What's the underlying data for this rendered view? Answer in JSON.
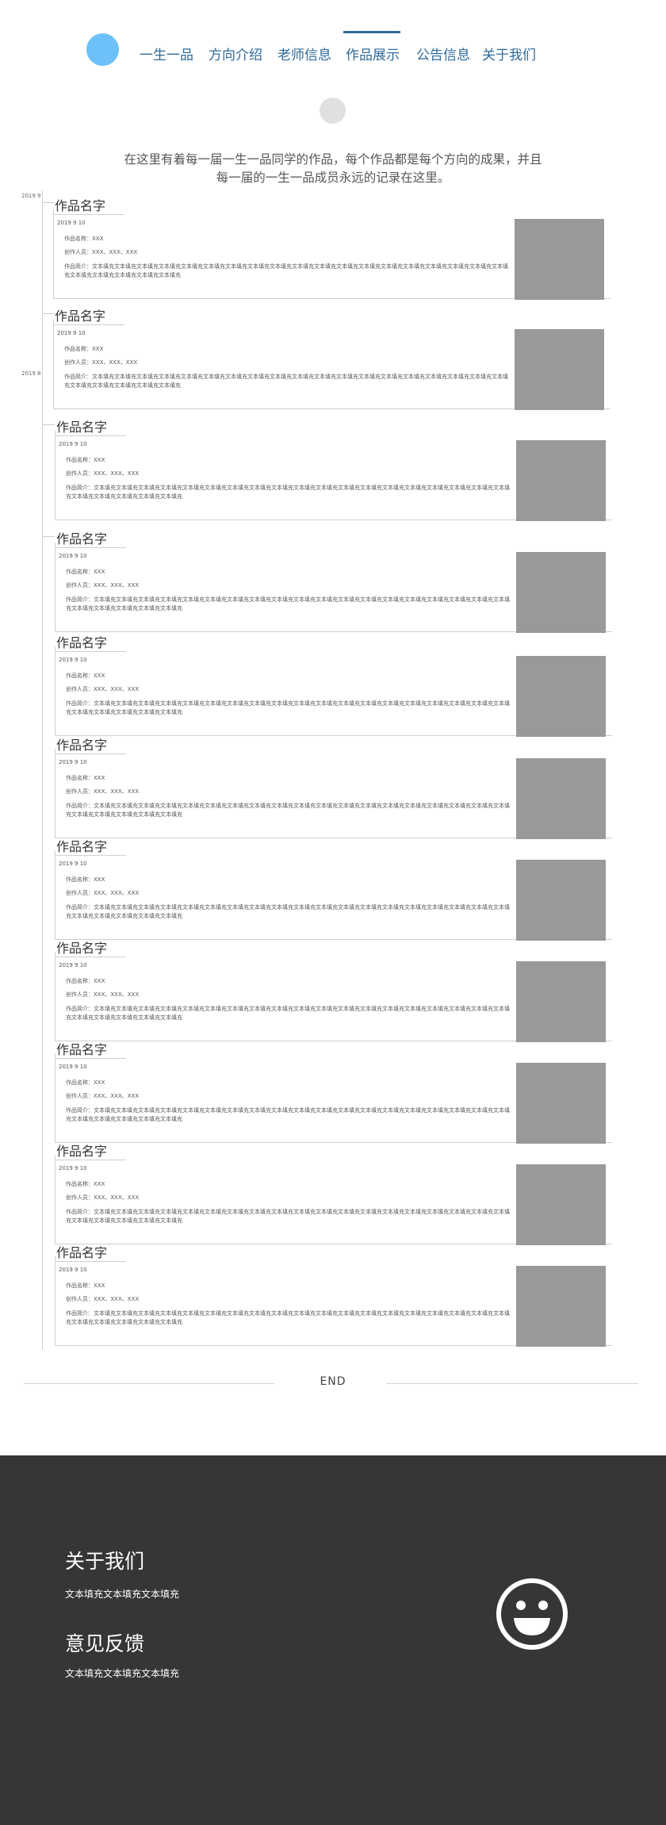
{
  "nav": {
    "items": [
      {
        "label": "一生一品"
      },
      {
        "label": "方向介绍"
      },
      {
        "label": "老师信息"
      },
      {
        "label": "作品展示",
        "active": true
      },
      {
        "label": "公告信息"
      },
      {
        "label": "关于我们"
      }
    ]
  },
  "intro": {
    "text": "在这里有着每一届一生一品同学的作品，每个作品都是每个方向的成果，并且每一届的一生一品成员永远的记录在这里。"
  },
  "timeline": {
    "dates": [
      "2019 9",
      "2019 8"
    ]
  },
  "works": [
    {
      "title": "作品名字",
      "date": "2019 9 10",
      "name": "作品名称：XXX",
      "authors": "创作人员：XXX、XXX、XXX",
      "desc": "作品简介：文本填充文本填充文本填充文本填充文本填充文本填充文本填充文本填充文本填充文本填充文本填充文本填充文本填充文本填充文本填充文本填充文本填充文本填充文本填充文本填充文本填充文本填充文本填充文本填充"
    },
    {
      "title": "作品名字",
      "date": "2019 9 10",
      "name": "作品名称：XXX",
      "authors": "创作人员：XXX、XXX、XXX",
      "desc": "作品简介：文本填充文本填充文本填充文本填充文本填充文本填充文本填充文本填充文本填充文本填充文本填充文本填充文本填充文本填充文本填充文本填充文本填充文本填充文本填充文本填充文本填充文本填充文本填充文本填充"
    },
    {
      "title": "作品名字",
      "date": "2019 9 10",
      "name": "作品名称：XXX",
      "authors": "创作人员：XXX、XXX、XXX",
      "desc": "作品简介：文本填充文本填充文本填充文本填充文本填充文本填充文本填充文本填充文本填充文本填充文本填充文本填充文本填充文本填充文本填充文本填充文本填充文本填充文本填充文本填充文本填充文本填充文本填充文本填充"
    },
    {
      "title": "作品名字",
      "date": "2019 9 10",
      "name": "作品名称：XXX",
      "authors": "创作人员：XXX、XXX、XXX",
      "desc": "作品简介：文本填充文本填充文本填充文本填充文本填充文本填充文本填充文本填充文本填充文本填充文本填充文本填充文本填充文本填充文本填充文本填充文本填充文本填充文本填充文本填充文本填充文本填充文本填充文本填充"
    },
    {
      "title": "作品名字",
      "date": "2019 9 10",
      "name": "作品名称：XXX",
      "authors": "创作人员：XXX、XXX、XXX",
      "desc": "作品简介：文本填充文本填充文本填充文本填充文本填充文本填充文本填充文本填充文本填充文本填充文本填充文本填充文本填充文本填充文本填充文本填充文本填充文本填充文本填充文本填充文本填充文本填充文本填充文本填充"
    },
    {
      "title": "作品名字",
      "date": "2019 9 10",
      "name": "作品名称：XXX",
      "authors": "创作人员：XXX、XXX、XXX",
      "desc": "作品简介：文本填充文本填充文本填充文本填充文本填充文本填充文本填充文本填充文本填充文本填充文本填充文本填充文本填充文本填充文本填充文本填充文本填充文本填充文本填充文本填充文本填充文本填充文本填充文本填充"
    },
    {
      "title": "作品名字",
      "date": "2019 9 10",
      "name": "作品名称：XXX",
      "authors": "创作人员：XXX、XXX、XXX",
      "desc": "作品简介：文本填充文本填充文本填充文本填充文本填充文本填充文本填充文本填充文本填充文本填充文本填充文本填充文本填充文本填充文本填充文本填充文本填充文本填充文本填充文本填充文本填充文本填充文本填充文本填充"
    },
    {
      "title": "作品名字",
      "date": "2019 9 10",
      "name": "作品名称：XXX",
      "authors": "创作人员：XXX、XXX、XXX",
      "desc": "作品简介：文本填充文本填充文本填充文本填充文本填充文本填充文本填充文本填充文本填充文本填充文本填充文本填充文本填充文本填充文本填充文本填充文本填充文本填充文本填充文本填充文本填充文本填充文本填充文本填充"
    },
    {
      "title": "作品名字",
      "date": "2019 9 10",
      "name": "作品名称：XXX",
      "authors": "创作人员：XXX、XXX、XXX",
      "desc": "作品简介：文本填充文本填充文本填充文本填充文本填充文本填充文本填充文本填充文本填充文本填充文本填充文本填充文本填充文本填充文本填充文本填充文本填充文本填充文本填充文本填充文本填充文本填充文本填充文本填充"
    },
    {
      "title": "作品名字",
      "date": "2019 9 10",
      "name": "作品名称：XXX",
      "authors": "创作人员：XXX、XXX、XXX",
      "desc": "作品简介：文本填充文本填充文本填充文本填充文本填充文本填充文本填充文本填充文本填充文本填充文本填充文本填充文本填充文本填充文本填充文本填充文本填充文本填充文本填充文本填充文本填充文本填充文本填充文本填充"
    },
    {
      "title": "作品名字",
      "date": "2019 9 10",
      "name": "作品名称：XXX",
      "authors": "创作人员：XXX、XXX、XXX",
      "desc": "作品简介：文本填充文本填充文本填充文本填充文本填充文本填充文本填充文本填充文本填充文本填充文本填充文本填充文本填充文本填充文本填充文本填充文本填充文本填充文本填充文本填充文本填充文本填充文本填充文本填充"
    }
  ],
  "end": {
    "text": "END"
  },
  "footer": {
    "about_title": "关于我们",
    "about_text": "文本填充文本填充文本填充",
    "feedback_title": "意见反馈",
    "feedback_text": "文本填充文本填充文本填充",
    "icon": "smiley-icon"
  }
}
